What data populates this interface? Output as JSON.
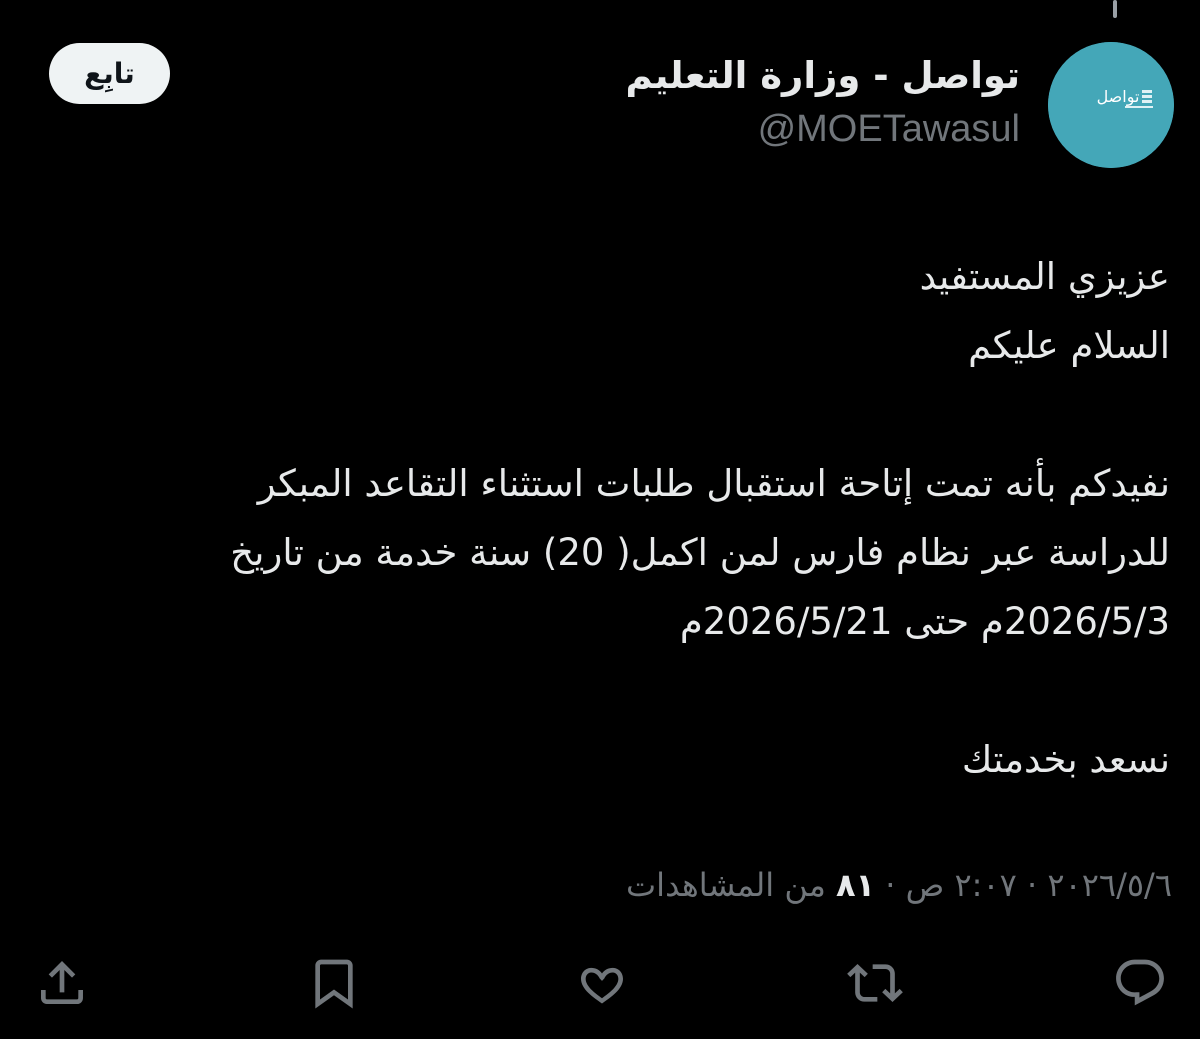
{
  "header": {
    "display_name": "تواصل - وزارة التعليم",
    "handle": "@MOETawasul",
    "avatar_text": "تواصل",
    "follow_label": "تابِع"
  },
  "tweet": {
    "lines": [
      "عزيزي المستفيد",
      "السلام عليكم",
      "",
      "نفيدكم بأنه تمت إتاحة استقبال طلبات استثناء التقاعد المبكر",
      "للدراسة عبر نظام فارس لمن اكمل( 20) سنة خدمة من تاريخ",
      "2026/5/3م حتى 2026/5/21م",
      "",
      "نسعد بخدمتك"
    ]
  },
  "meta": {
    "date": "٢٠٢٦/٥/٦",
    "time": "٢:٠٧ ص",
    "separator": "·",
    "views_count": "٨١",
    "views_label": "من المشاهدات"
  },
  "actions": {
    "reply_icon": "reply-icon",
    "retweet_icon": "retweet-icon",
    "like_icon": "like-icon",
    "bookmark_icon": "bookmark-icon",
    "share_icon": "share-icon"
  },
  "colors": {
    "background": "#000000",
    "text": "#e7e9ea",
    "muted": "#71767b",
    "avatar_bg": "#44a7b8",
    "follow_bg": "#eff3f4"
  }
}
